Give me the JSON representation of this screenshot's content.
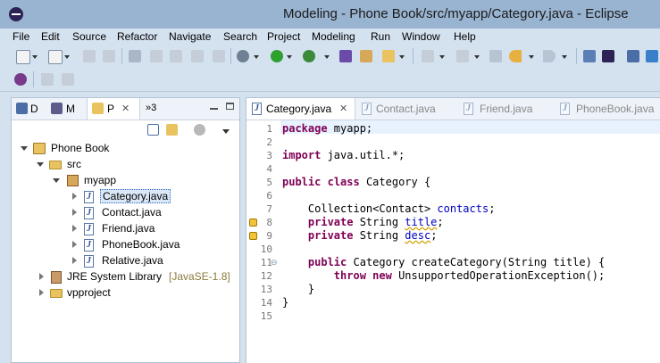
{
  "window": {
    "title": "Modeling - Phone Book/src/myapp/Category.java - Eclipse"
  },
  "menubar": {
    "items": [
      "File",
      "Edit",
      "Source",
      "Refactor",
      "Navigate",
      "Search",
      "Project",
      "Modeling",
      "Run",
      "Window",
      "Help"
    ]
  },
  "explorer": {
    "tabs": [
      {
        "label": "D",
        "icon": "package-explorer-icon"
      },
      {
        "label": "M",
        "icon": "model-explorer-icon"
      },
      {
        "label": "P",
        "icon": "project-explorer-icon",
        "active": true
      },
      {
        "label": "»3",
        "icon": "more-views-icon"
      }
    ],
    "tree": [
      {
        "label": "Phone Book",
        "icon": "project-icon",
        "depth": 0,
        "expanded": true
      },
      {
        "label": "src",
        "icon": "source-folder-icon",
        "depth": 1,
        "expanded": true
      },
      {
        "label": "myapp",
        "icon": "package-icon",
        "depth": 2,
        "expanded": true
      },
      {
        "label": "Category.java",
        "icon": "java-file-icon",
        "depth": 3,
        "expanded": false,
        "selected": true
      },
      {
        "label": "Contact.java",
        "icon": "java-file-icon",
        "depth": 3,
        "expanded": false
      },
      {
        "label": "Friend.java",
        "icon": "java-file-icon",
        "depth": 3,
        "expanded": false
      },
      {
        "label": "PhoneBook.java",
        "icon": "java-file-icon",
        "depth": 3,
        "expanded": false
      },
      {
        "label": "Relative.java",
        "icon": "java-file-icon",
        "depth": 3,
        "expanded": false
      },
      {
        "label": "JRE System Library",
        "decoration": "[JavaSE-1.8]",
        "icon": "library-icon",
        "depth": 1,
        "expanded": false
      },
      {
        "label": "vpproject",
        "icon": "folder-icon",
        "depth": 1,
        "expanded": false
      }
    ]
  },
  "editor": {
    "tabs": [
      {
        "label": "Category.java",
        "active": true
      },
      {
        "label": "Contact.java"
      },
      {
        "label": "Friend.java"
      },
      {
        "label": "PhoneBook.java"
      }
    ],
    "lines": [
      {
        "n": "1",
        "segments": [
          {
            "t": "package",
            "c": "kw"
          },
          {
            "t": " myapp;"
          }
        ]
      },
      {
        "n": "2",
        "segments": []
      },
      {
        "n": "3",
        "segments": [
          {
            "t": "import",
            "c": "kw"
          },
          {
            "t": " java.util.*;"
          }
        ]
      },
      {
        "n": "4",
        "segments": []
      },
      {
        "n": "5",
        "segments": [
          {
            "t": "public",
            "c": "kw"
          },
          {
            "t": " "
          },
          {
            "t": "class",
            "c": "kw"
          },
          {
            "t": " Category {"
          }
        ]
      },
      {
        "n": "6",
        "segments": []
      },
      {
        "n": "7",
        "segments": [
          {
            "t": "    Collection<Contact> "
          },
          {
            "t": "contacts",
            "c": "fld"
          },
          {
            "t": ";"
          }
        ]
      },
      {
        "n": "8",
        "segments": [
          {
            "t": "    "
          },
          {
            "t": "private",
            "c": "kw"
          },
          {
            "t": " String "
          },
          {
            "t": "title",
            "c": "fld wv"
          },
          {
            "t": ";"
          }
        ],
        "warning": true
      },
      {
        "n": "9",
        "segments": [
          {
            "t": "    "
          },
          {
            "t": "private",
            "c": "kw"
          },
          {
            "t": " String "
          },
          {
            "t": "desc",
            "c": "fld wv"
          },
          {
            "t": ";"
          }
        ],
        "warning": true
      },
      {
        "n": "10",
        "segments": []
      },
      {
        "n": "11",
        "segments": [
          {
            "t": "    "
          },
          {
            "t": "public",
            "c": "kw"
          },
          {
            "t": " Category createCategory(String title) {"
          }
        ],
        "fold": true
      },
      {
        "n": "12",
        "segments": [
          {
            "t": "        "
          },
          {
            "t": "throw",
            "c": "kw"
          },
          {
            "t": " "
          },
          {
            "t": "new",
            "c": "kw"
          },
          {
            "t": " UnsupportedOperationException();"
          }
        ]
      },
      {
        "n": "13",
        "segments": [
          {
            "t": "    }"
          }
        ]
      },
      {
        "n": "14",
        "segments": [
          {
            "t": "}"
          }
        ]
      },
      {
        "n": "15",
        "segments": []
      }
    ]
  }
}
